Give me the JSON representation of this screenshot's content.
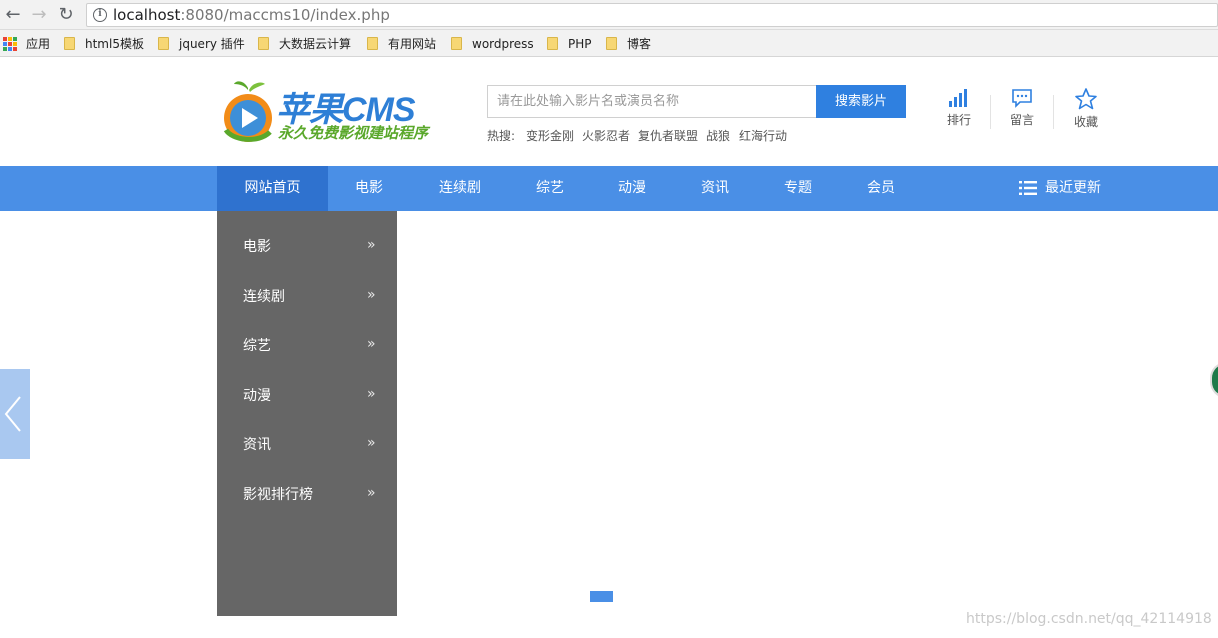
{
  "browser": {
    "url_host": "localhost",
    "url_rest": ":8080/maccms10/index.php",
    "bookmarks": [
      "应用",
      "html5模板",
      "jquery 插件",
      "大数据云计算",
      "有用网站",
      "wordpress",
      "PHP",
      "博客"
    ]
  },
  "header": {
    "logo_main": "苹果CMS",
    "logo_sub": "永久免费影视建站程序",
    "search_placeholder": "请在此处输入影片名或演员名称",
    "search_button": "搜索影片",
    "hot_label": "热搜:",
    "hot_items": [
      "变形金刚",
      "火影忍者",
      "复仇者联盟",
      "战狼",
      "红海行动"
    ],
    "tools": [
      {
        "label": "排行",
        "icon": "bar-chart-icon"
      },
      {
        "label": "留言",
        "icon": "message-icon"
      },
      {
        "label": "收藏",
        "icon": "star-icon"
      }
    ]
  },
  "nav": {
    "items": [
      "网站首页",
      "电影",
      "连续剧",
      "综艺",
      "动漫",
      "资讯",
      "专题",
      "会员"
    ],
    "recent": "最近更新"
  },
  "dropdown": {
    "items": [
      "电影",
      "连续剧",
      "综艺",
      "动漫",
      "资讯",
      "影视排行榜"
    ],
    "arrow": "»"
  },
  "watermark": "https://blog.csdn.net/qq_42114918",
  "colors": {
    "brand_blue": "#4a8fe6",
    "active_blue": "#2f72cf",
    "dropdown_bg": "#666666",
    "logo_green": "#5aa82b"
  }
}
